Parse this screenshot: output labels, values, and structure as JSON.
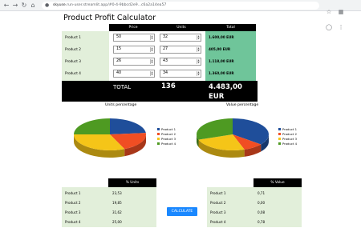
{
  "browser": {
    "url_host": "skyuse",
    "url_rest": ".run-user.streamlit.app/#0-4-9bbcd2e9...c6a2a14ea57"
  },
  "page": {
    "title": "Product Profit Calculator"
  },
  "calculator": {
    "headers": [
      "Price",
      "Units",
      "Total"
    ],
    "rows": [
      {
        "name": "Product 1",
        "price": "50",
        "units": "32",
        "total": "1.600,00 EUR"
      },
      {
        "name": "Product 2",
        "price": "15",
        "units": "27",
        "total": "405,00 EUR"
      },
      {
        "name": "Product 3",
        "price": "26",
        "units": "43",
        "total": "1.118,00 EUR"
      },
      {
        "name": "Product 4",
        "price": "40",
        "units": "34",
        "total": "1.360,00 EUR"
      }
    ],
    "total_label": "TOTAL",
    "total_units": "136",
    "total_amount": "4.483,00",
    "total_currency": "EUR"
  },
  "chart_data": [
    {
      "type": "pie",
      "title": "Units percentage",
      "categories": [
        "Product 1",
        "Product 2",
        "Product 3",
        "Product 4"
      ],
      "values": [
        23.53,
        19.85,
        31.62,
        25.0
      ],
      "colors": [
        "#1f4e9a",
        "#f04e23",
        "#f5c518",
        "#4e9a22"
      ],
      "legend_placement": "right"
    },
    {
      "type": "pie",
      "title": "Value percentage",
      "categories": [
        "Product 1",
        "Product 2",
        "Product 3",
        "Product 4"
      ],
      "values": [
        35.71,
        9.03,
        24.94,
        30.34
      ],
      "colors": [
        "#1f4e9a",
        "#f04e23",
        "#f5c518",
        "#4e9a22"
      ],
      "legend_placement": "right"
    }
  ],
  "units_table": {
    "header": "% Units",
    "rows": [
      {
        "name": "Product 1",
        "value": "23,53"
      },
      {
        "name": "Product 2",
        "value": "19,85"
      },
      {
        "name": "Product 3",
        "value": "31,62"
      },
      {
        "name": "Product 4",
        "value": "25,00"
      }
    ]
  },
  "value_table": {
    "header": "% Value",
    "rows": [
      {
        "name": "Product 1",
        "value": "0,71"
      },
      {
        "name": "Product 2",
        "value": "0,00"
      },
      {
        "name": "Product 3",
        "value": "0,08"
      },
      {
        "name": "Product 4",
        "value": "0,78"
      }
    ]
  },
  "button": {
    "label": "CALCULATE"
  }
}
